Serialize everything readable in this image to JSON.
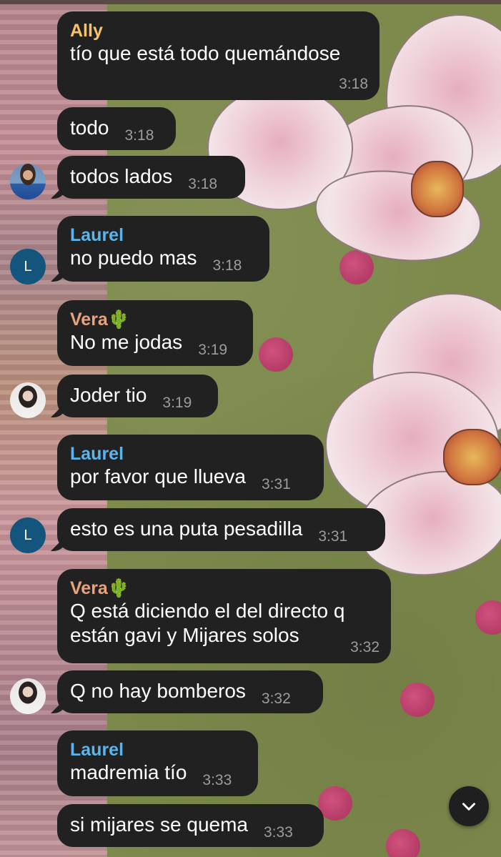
{
  "colors": {
    "bubble": "#212121",
    "text": "#ffffff",
    "time": "#9c9c9c",
    "ally": "#f4c46b",
    "laurel": "#5db4ea",
    "vera": "#e8a27e",
    "avatar_l": "#14557d"
  },
  "messages": [
    {
      "sender": "Ally",
      "text": "tío que está todo quemándose",
      "time": "3:18"
    },
    {
      "text": "todo",
      "time": "3:18"
    },
    {
      "text": "todos lados",
      "time": "3:18"
    },
    {
      "sender": "Laurel",
      "text": "no puedo mas",
      "time": "3:18",
      "avatar": "L"
    },
    {
      "sender": "Vera",
      "sender_emoji": "🌵",
      "text": "No me jodas",
      "time": "3:19"
    },
    {
      "text": "Joder tio",
      "time": "3:19"
    },
    {
      "sender": "Laurel",
      "text": "por favor que llueva",
      "time": "3:31"
    },
    {
      "text": "esto es una puta pesadilla",
      "time": "3:31",
      "avatar": "L"
    },
    {
      "sender": "Vera",
      "sender_emoji": "🌵",
      "text_lines": [
        "Q está diciendo el del directo q",
        "están gavi y Mijares solos"
      ],
      "time": "3:32"
    },
    {
      "text": "Q no hay bomberos",
      "time": "3:32"
    },
    {
      "sender": "Laurel",
      "text": "madremia tío",
      "time": "3:33"
    },
    {
      "text": "si mijares se quema",
      "time": "3:33"
    }
  ],
  "scroll_button_icon": "chevron-down-icon"
}
